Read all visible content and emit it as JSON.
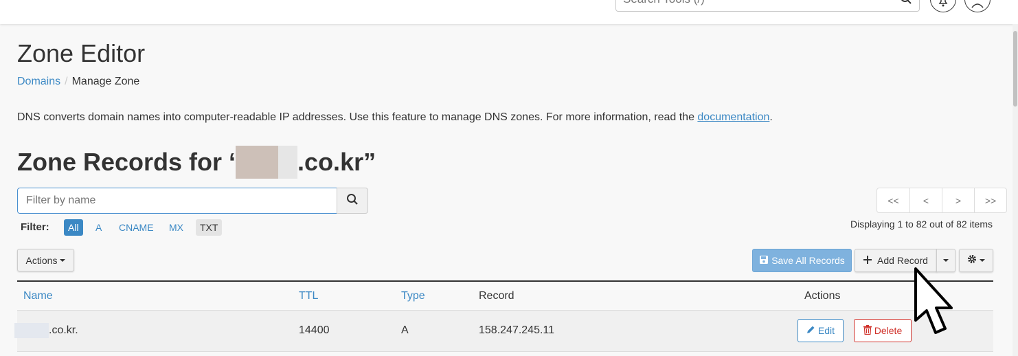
{
  "header": {
    "search_placeholder": "Search Tools (/)",
    "icons": [
      "search-icon",
      "bell-icon",
      "user-icon"
    ]
  },
  "page": {
    "title": "Zone Editor",
    "breadcrumb": [
      {
        "label": "Domains",
        "link": true
      },
      {
        "label": "Manage Zone",
        "link": false
      }
    ],
    "description_text": "DNS converts domain names into computer-readable IP addresses. Use this feature to manage DNS zones. For more information, read the ",
    "description_link": "documentation",
    "description_end": "."
  },
  "zone": {
    "heading_prefix": "Zone Records for ‘",
    "heading_suffix": ".co.kr”"
  },
  "filter": {
    "placeholder": "Filter by name",
    "label": "Filter:",
    "chips": [
      "All",
      "A",
      "CNAME",
      "MX",
      "TXT"
    ],
    "active_chip": "All"
  },
  "pagination": {
    "buttons": [
      "<<",
      "<",
      ">",
      ">>"
    ],
    "status": "Displaying 1 to 82 out of 82 items"
  },
  "toolbar": {
    "actions_label": "Actions",
    "save_label": "Save All Records",
    "add_label": "Add Record"
  },
  "table": {
    "columns": [
      "Name",
      "TTL",
      "Type",
      "Record",
      "Actions"
    ],
    "rows": [
      {
        "name": ".co.kr.",
        "ttl": "14400",
        "type": "A",
        "record": "158.247.245.11",
        "edit": "Edit",
        "delete": "Delete"
      }
    ]
  },
  "colors": {
    "link": "#3b88c4",
    "primary_disabled": "#7fb2de",
    "danger": "#d0322b"
  }
}
